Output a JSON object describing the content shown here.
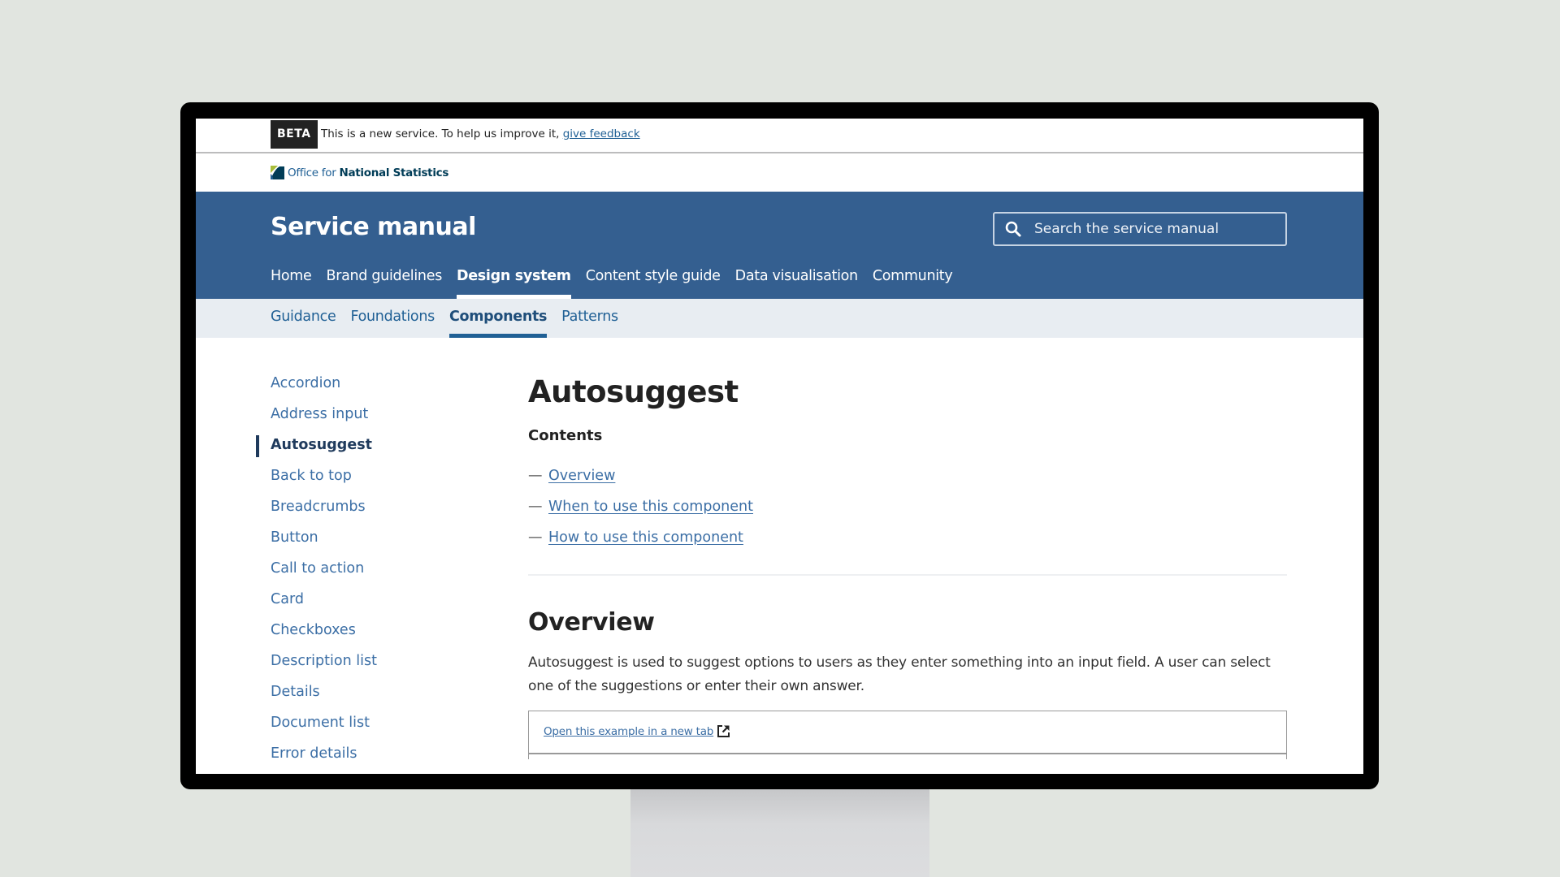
{
  "beta_banner": {
    "badge": "BETA",
    "text": "This is a new service. To help us improve it, ",
    "link": "give feedback"
  },
  "logo": {
    "prefix": "Office for ",
    "name": "National Statistics"
  },
  "header": {
    "title": "Service manual",
    "search_placeholder": "Search the service manual"
  },
  "main_nav": [
    {
      "label": "Home",
      "active": false
    },
    {
      "label": "Brand guidelines",
      "active": false
    },
    {
      "label": "Design system",
      "active": true
    },
    {
      "label": "Content style guide",
      "active": false
    },
    {
      "label": "Data visualisation",
      "active": false
    },
    {
      "label": "Community",
      "active": false
    }
  ],
  "sub_nav": [
    {
      "label": "Guidance",
      "active": false
    },
    {
      "label": "Foundations",
      "active": false
    },
    {
      "label": "Components",
      "active": true
    },
    {
      "label": "Patterns",
      "active": false
    }
  ],
  "sidebar": [
    {
      "label": "Accordion",
      "active": false
    },
    {
      "label": "Address input",
      "active": false
    },
    {
      "label": "Autosuggest",
      "active": true
    },
    {
      "label": "Back to top",
      "active": false
    },
    {
      "label": "Breadcrumbs",
      "active": false
    },
    {
      "label": "Button",
      "active": false
    },
    {
      "label": "Call to action",
      "active": false
    },
    {
      "label": "Card",
      "active": false
    },
    {
      "label": "Checkboxes",
      "active": false
    },
    {
      "label": "Description list",
      "active": false
    },
    {
      "label": "Details",
      "active": false
    },
    {
      "label": "Document list",
      "active": false
    },
    {
      "label": "Error details",
      "active": false
    }
  ],
  "content": {
    "title": "Autosuggest",
    "contents_heading": "Contents",
    "toc": [
      {
        "dash": "—",
        "label": "Overview"
      },
      {
        "dash": "—",
        "label": "When to use this component"
      },
      {
        "dash": "—",
        "label": "How to use this component"
      }
    ],
    "overview_heading": "Overview",
    "overview_text": "Autosuggest is used to suggest options to users as they enter something into an input field. A user can select one of the suggestions or enter their own answer.",
    "example_link": "Open this example in a new tab",
    "example_link_icon": "external-link-icon"
  },
  "colors": {
    "header_blue": "#345f90",
    "link_blue": "#206095",
    "subnav_bg": "#e8edf2",
    "active_indicator": "#1f3a5c",
    "background": "#e1e5e0"
  }
}
